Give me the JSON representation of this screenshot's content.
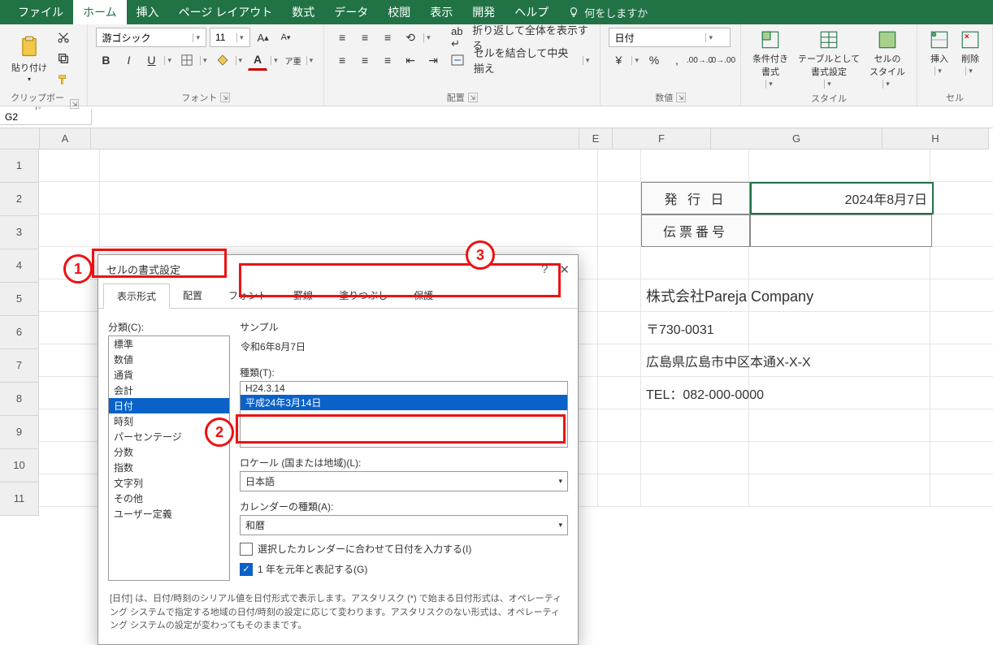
{
  "ribbon": {
    "tabs": [
      "ファイル",
      "ホーム",
      "挿入",
      "ページ レイアウト",
      "数式",
      "データ",
      "校閲",
      "表示",
      "開発",
      "ヘルプ"
    ],
    "active_tab": "ホーム",
    "tell_me": "何をしますか",
    "clipboard": {
      "paste": "貼り付け",
      "group": "クリップボード"
    },
    "font": {
      "name": "游ゴシック",
      "size": "11",
      "group": "フォント",
      "bold": "B",
      "italic": "I",
      "underline": "U",
      "ruby": "ア亜"
    },
    "align": {
      "wrap": "折り返して全体を表示する",
      "merge": "セルを結合して中央揃え",
      "group": "配置"
    },
    "number": {
      "format": "日付",
      "group": "数値"
    },
    "styles": {
      "cond": "条件付き\n書式",
      "table": "テーブルとして\n書式設定",
      "cell": "セルの\nスタイル",
      "group": "スタイル"
    },
    "cells": {
      "insert": "挿入",
      "delete": "削除",
      "group": "セル"
    }
  },
  "namebox": "G2",
  "columns": [
    "A",
    "",
    "E",
    "F",
    "G",
    "H"
  ],
  "rowcount": 11,
  "sheet": {
    "f2": "発 行 日",
    "g2": "2024年8月7日",
    "f3": "伝票番号",
    "f5": "株式会社Pareja Company",
    "f6": "〒730-0031",
    "f7": "広島県広島市中区本通X-X-X",
    "f8": "TEL：082-000-0000"
  },
  "dialog": {
    "title": "セルの書式設定",
    "tabs": [
      "表示形式",
      "配置",
      "フォント",
      "罫線",
      "塗りつぶし",
      "保護"
    ],
    "category_label": "分類(C):",
    "categories": [
      "標準",
      "数値",
      "通貨",
      "会計",
      "日付",
      "時刻",
      "パーセンテージ",
      "分数",
      "指数",
      "文字列",
      "その他",
      "ユーザー定義"
    ],
    "selected_category": "日付",
    "sample_label": "サンプル",
    "sample_value": "令和6年8月7日",
    "type_label": "種類(T):",
    "types": [
      "H24.3.14",
      "平成24年3月14日"
    ],
    "selected_type": "平成24年3月14日",
    "locale_label": "ロケール (国または地域)(L):",
    "locale_value": "日本語",
    "calendar_label": "カレンダーの種類(A):",
    "calendar_value": "和暦",
    "chk1": "選択したカレンダーに合わせて日付を入力する(I)",
    "chk2": "1 年を元年と表記する(G)",
    "explain": "[日付] は、日付/時刻のシリアル値を日付形式で表示します。アスタリスク (*) で始まる日付形式は、オペレーティング システムで指定する地域の日付/時刻の設定に応じて変わります。アスタリスクのない形式は、オペレーティング システムの設定が変わってもそのままです。"
  },
  "badges": {
    "1": "1",
    "2": "2",
    "3": "3"
  }
}
